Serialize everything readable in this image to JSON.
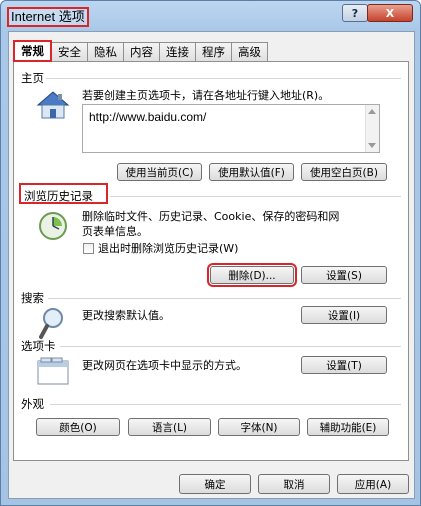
{
  "window": {
    "title": "Internet 选项",
    "help_label": "?",
    "close_label": "X"
  },
  "tabs": [
    {
      "label": "常规"
    },
    {
      "label": "安全"
    },
    {
      "label": "隐私"
    },
    {
      "label": "内容"
    },
    {
      "label": "连接"
    },
    {
      "label": "程序"
    },
    {
      "label": "高级"
    }
  ],
  "homepage": {
    "title": "主页",
    "description": "若要创建主页选项卡，请在各地址行键入地址(R)。",
    "url": "http://www.baidu.com/",
    "use_current": "使用当前页(C)",
    "use_default": "使用默认值(F)",
    "use_blank": "使用空白页(B)"
  },
  "history": {
    "title": "浏览历史记录",
    "description": "删除临时文件、历史记录、Cookie、保存的密码和网页表单信息。",
    "checkbox_label": "退出时删除浏览历史记录(W)",
    "delete_label": "删除(D)...",
    "settings_label": "设置(S)"
  },
  "search": {
    "title": "搜索",
    "description": "更改搜索默认值。",
    "settings_label": "设置(I)"
  },
  "tabs_section": {
    "title": "选项卡",
    "description": "更改网页在选项卡中显示的方式。",
    "settings_label": "设置(T)"
  },
  "appearance": {
    "title": "外观",
    "colors": "颜色(O)",
    "languages": "语言(L)",
    "fonts": "字体(N)",
    "accessibility": "辅助功能(E)"
  },
  "footer": {
    "ok": "确定",
    "cancel": "取消",
    "apply": "应用(A)"
  },
  "colors": {
    "highlight": "#d9262b",
    "title_bar": "#bcd6f0"
  }
}
